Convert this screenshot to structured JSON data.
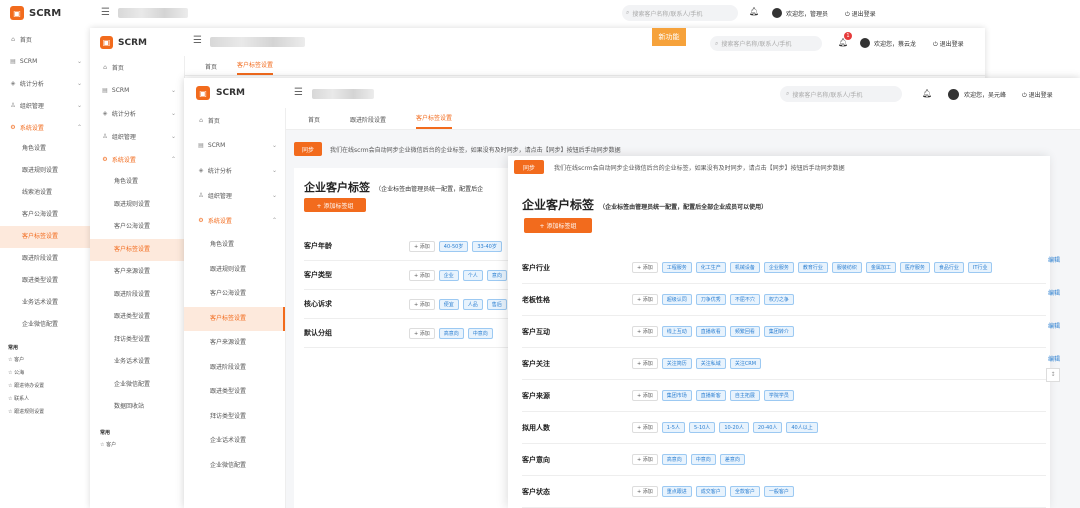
{
  "brand": "SCRM",
  "search_placeholder": "搜索客户名称/联系人/手机",
  "welcome": [
    "欢迎您，管理员",
    "欢迎您，蔡云龙",
    "欢迎您，吴元峰"
  ],
  "logout": "退出登录",
  "new_version_badge": "新功能",
  "notif_count": "1",
  "accent": "#f26b1d",
  "win1": {
    "menu": [
      "首页",
      "SCRM",
      "统计分析",
      "组织管理",
      "系统设置"
    ],
    "submenu": [
      "角色设置",
      "跟进规则设置",
      "线索池设置",
      "客户公海设置",
      "客户标签设置",
      "跟进阶段设置",
      "跟进类型设置",
      "业务话术设置",
      "企业微信配置"
    ],
    "common_title": "常用",
    "common": [
      "客户",
      "公海",
      "跟进待办设置",
      "联系人",
      "跟进规则设置"
    ]
  },
  "win2": {
    "menu": [
      "首页",
      "SCRM",
      "统计分析",
      "组织管理",
      "系统设置"
    ],
    "submenu": [
      "角色设置",
      "跟进规则设置",
      "客户公海设置",
      "客户标签设置",
      "客户来源设置",
      "跟进阶段设置",
      "跟进类型设置",
      "拜访类型设置",
      "业务话术设置",
      "企业微信配置",
      "数据回收站"
    ],
    "common_title": "常用",
    "common": [
      "客户"
    ],
    "tabs": [
      "首页",
      "客户标签设置"
    ]
  },
  "win3": {
    "menu": [
      "首页",
      "SCRM",
      "统计分析",
      "组织管理",
      "系统设置"
    ],
    "submenu": [
      "角色设置",
      "跟进规则设置",
      "客户公海设置",
      "客户标签设置",
      "客户来源设置",
      "跟进阶段设置",
      "跟进类型设置",
      "拜访类型设置",
      "企业话术设置",
      "企业微信配置"
    ],
    "tabs": [
      "首页",
      "跟进阶段设置",
      "客户标签设置"
    ],
    "sync": "同步",
    "sync_note": "我们在线scrm会自动同步企业微信后台的企业标签，如果没有及时同步，请点击【同步】按钮后手动同步数据",
    "title": "企业客户标签",
    "subtitle": "（企业标签由管理员统一配置，配置后企",
    "add_group": "+ 添加标签组",
    "plus": "+ 添加",
    "rows": [
      {
        "label": "客户年龄",
        "tags": [
          "40-50岁",
          "33-40岁"
        ]
      },
      {
        "label": "客户类型",
        "tags": [
          "企业",
          "个人",
          "意向"
        ]
      },
      {
        "label": "核心诉求",
        "tags": [
          "便宜",
          "人品",
          "售后"
        ]
      },
      {
        "label": "默认分组",
        "tags": [
          "高意向",
          "中意向"
        ]
      }
    ]
  },
  "win4": {
    "sync": "同步",
    "sync_note": "我们在线scrm会自动同步企业微信后台的企业标签，如果没有及时同步，请点击【同步】按钮后手动同步数据",
    "title": "企业客户标签",
    "subtitle": "（企业标签由管理员统一配置，配置后全部企业成员可以使用）",
    "add_group": "+ 添加标签组",
    "plus": "+ 添加",
    "edit": "编辑",
    "rows": [
      {
        "label": "客户行业",
        "tags": [
          "工程服务",
          "化工生产",
          "机械设备",
          "企业服务",
          "教育行业",
          "服装纺织",
          "金属加工",
          "医疗服务",
          "食品行业",
          "IT行业"
        ]
      },
      {
        "label": "老板性格",
        "tags": [
          "超级认同",
          "刀争优秀",
          "不屈不穴",
          "权力之争"
        ]
      },
      {
        "label": "客户互动",
        "tags": [
          "线上互动",
          "直播收看",
          "频繁回看",
          "集团转介"
        ]
      },
      {
        "label": "客户关注",
        "tags": [
          "关注简历",
          "关注私域",
          "关注CRM"
        ]
      },
      {
        "label": "客户来源",
        "tags": [
          "集团市场",
          "直播新客",
          "自主拓展",
          "学院学员"
        ]
      },
      {
        "label": "拟用人数",
        "tags": [
          "1-5人",
          "5-10人",
          "10-20人",
          "20-40人",
          "40人以上"
        ]
      },
      {
        "label": "客户意向",
        "tags": [
          "高意向",
          "中意向",
          "差意向"
        ]
      },
      {
        "label": "客户状态",
        "tags": [
          "重点跟进",
          "成交客户",
          "全款客户",
          "一般客户"
        ]
      }
    ]
  }
}
